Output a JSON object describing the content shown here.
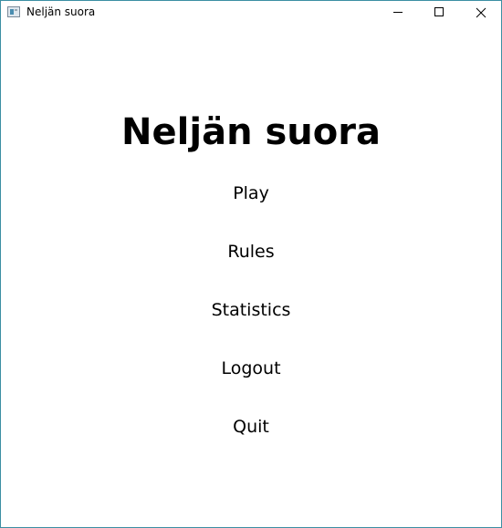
{
  "window": {
    "title": "Neljän suora",
    "border_color": "#3c8fa3",
    "icon": "app-window-icon",
    "controls": [
      "minimize-icon",
      "maximize-icon",
      "close-icon"
    ]
  },
  "menu": {
    "title": "Neljän suora",
    "items": [
      {
        "label": "Play"
      },
      {
        "label": "Rules"
      },
      {
        "label": "Statistics"
      },
      {
        "label": "Logout"
      },
      {
        "label": "Quit"
      }
    ]
  }
}
